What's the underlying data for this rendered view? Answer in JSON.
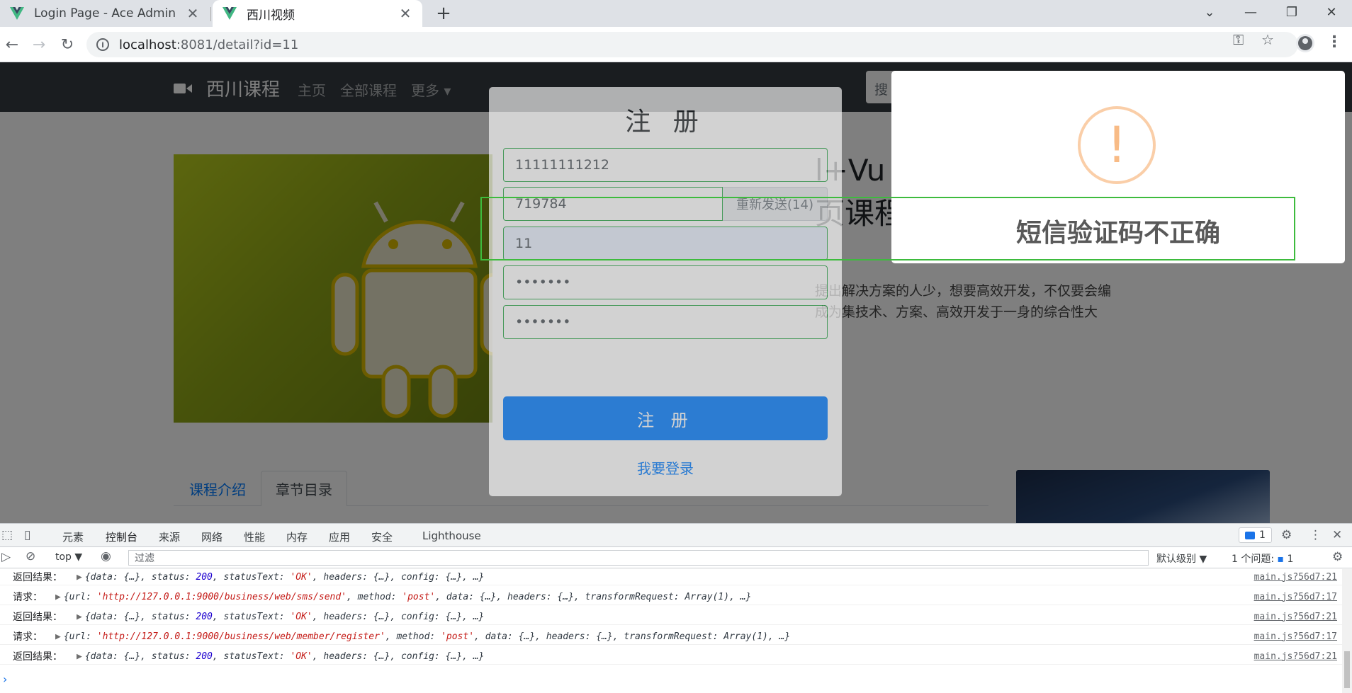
{
  "browser": {
    "tabs": [
      {
        "title": "Login Page - Ace Admin",
        "close": "✕"
      },
      {
        "title": "西川视频",
        "close": "✕"
      }
    ],
    "new_tab": "+",
    "window_controls": {
      "list": "⌄",
      "minimize": "—",
      "restore": "❐",
      "close": "✕"
    },
    "url_host": "localhost",
    "url_rest": ":8081/detail?id=11"
  },
  "site": {
    "brand": "西川课程",
    "nav": [
      "主页",
      "全部课程",
      "更多 ▾"
    ],
    "search_placeholder": "搜",
    "course_title_frag1": "l+Vu",
    "course_title_frag2": "页课程",
    "course_desc_line1": "提出解决方案的人少，想要高效开发，不仅要会编",
    "course_desc_line2": "成为集技术、方案、高效开发于一身的综合性大",
    "tabs": [
      "课程介绍",
      "章节目录"
    ]
  },
  "register_modal": {
    "title": "注 册",
    "phone_value": "11111111212",
    "sms_code_value": "719784",
    "resend_label": "重新发送(14)",
    "name_value": "11",
    "password_value": "•••••••",
    "confirm_password_value": "•••••••",
    "submit_label": "注 册",
    "login_link": "我要登录"
  },
  "alert": {
    "icon": "!",
    "message": "短信验证码不正确"
  },
  "devtools": {
    "tabs": [
      "元素",
      "控制台",
      "来源",
      "网络",
      "性能",
      "内存",
      "应用",
      "安全",
      "Lighthouse"
    ],
    "issue_count": "1",
    "context": "top ▼",
    "filter_placeholder": "过滤",
    "level": "默认级别 ▼",
    "issues_label": "1 个问题:",
    "issues_num": "1",
    "logs": [
      {
        "prefix": "返回结果：",
        "kind": "resp",
        "src": "main.js?56d7:21"
      },
      {
        "prefix": "请求：",
        "kind": "req",
        "url": "'http://127.0.0.1:9000/business/web/sms/send'",
        "src": "main.js?56d7:17"
      },
      {
        "prefix": "返回结果：",
        "kind": "resp",
        "src": "main.js?56d7:21"
      },
      {
        "prefix": "请求：",
        "kind": "req",
        "url": "'http://127.0.0.1:9000/business/web/member/register'",
        "src": "main.js?56d7:17"
      },
      {
        "prefix": "返回结果：",
        "kind": "resp",
        "src": "main.js?56d7:21"
      }
    ],
    "resp_text": {
      "a": "{data: {…}, status: ",
      "status": "200",
      "b": ", statusText: ",
      "st": "'OK'",
      "c": ", headers: {…}, config: {…}, …}"
    },
    "req_text": {
      "a": "{url: ",
      "b": ", method: ",
      "method": "'post'",
      "c": ", data: {…}, headers: {…}, transformRequest: Array(1), …}"
    },
    "prompt": "›"
  }
}
